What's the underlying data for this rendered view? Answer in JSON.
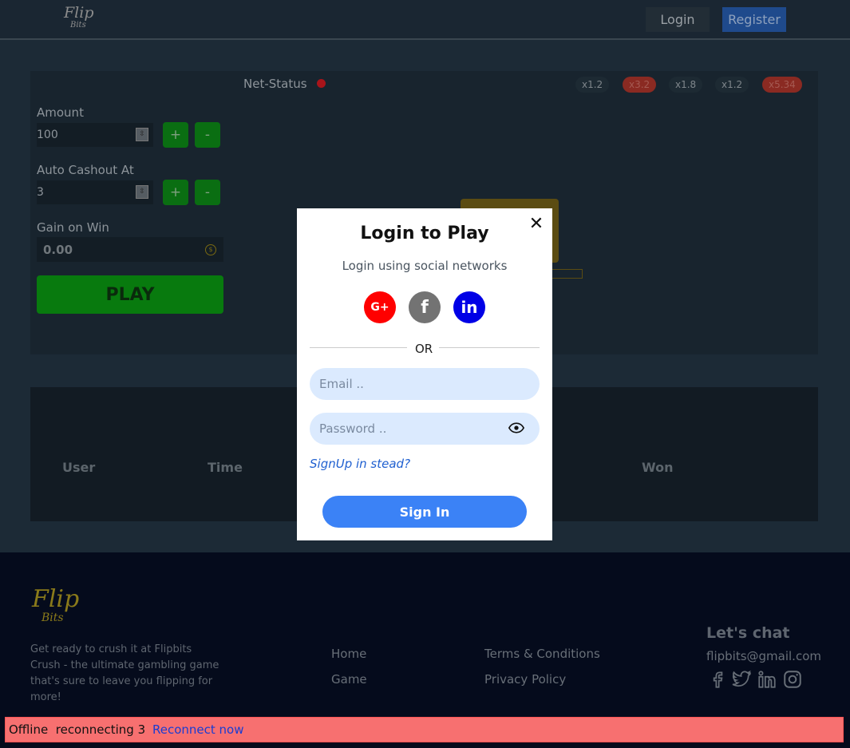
{
  "header": {
    "logo_line1": "Flip",
    "logo_line2": "Bits",
    "login_label": "Login",
    "register_label": "Register"
  },
  "game": {
    "net_status_label": "Net-Status",
    "net_status_color": "#a8141a",
    "multipliers": [
      {
        "label": "x1.2",
        "hot": false
      },
      {
        "label": "x3.2",
        "hot": true
      },
      {
        "label": "x1.8",
        "hot": false
      },
      {
        "label": "x1.2",
        "hot": false
      },
      {
        "label": "x5.34",
        "hot": true
      }
    ],
    "amount_label": "Amount",
    "amount_value": "100",
    "auto_cashout_label": "Auto Cashout At",
    "auto_cashout_value": "3",
    "plus_label": "+",
    "minus_label": "-",
    "gain_label": "Gain on Win",
    "gain_value": "0.00",
    "play_label": "PLAY"
  },
  "history": {
    "columns": [
      "User",
      "Time",
      "Won"
    ]
  },
  "modal": {
    "title": "Login to Play",
    "subtitle": "Login using social networks",
    "close_glyph": "✕",
    "google_glyph": "G+",
    "facebook_glyph": "f",
    "linkedin_glyph": "in",
    "or_text": "OR",
    "email_placeholder": "Email ..",
    "password_placeholder": "Password ..",
    "signup_text": "SignUp in stead?",
    "signin_label": "Sign In"
  },
  "footer": {
    "logo_line1": "Flip",
    "logo_line2": "Bits",
    "tagline": "Get ready to crush it at Flipbits Crush - the ultimate gambling game that's sure to leave you flipping for more!",
    "links": [
      "Home",
      "Game",
      "Terms & Conditions",
      "Privacy Policy"
    ],
    "chat_title": "Let's chat",
    "email": "flipbits@gmail.com",
    "social_icons": [
      "facebook-icon",
      "twitter-icon",
      "linkedin-icon",
      "instagram-icon"
    ]
  },
  "offline": {
    "status_text": "Offline  reconnecting 3",
    "reconnect_label": "Reconnect now"
  },
  "colors": {
    "accent_blue": "#3b82f6",
    "play_green": "#087a0e",
    "offline_red": "#f77070",
    "google_red": "#ff0000",
    "linkedin_blue": "#0000e6"
  }
}
